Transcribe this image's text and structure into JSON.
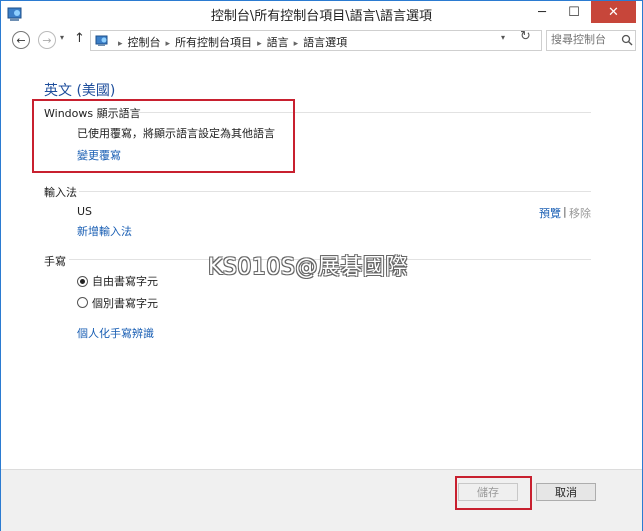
{
  "window": {
    "title": "控制台\\所有控制台項目\\語言\\語言選項",
    "minimize": "─",
    "maximize": "☐",
    "close": "✕"
  },
  "nav": {
    "back": "←",
    "forward": "→",
    "recent": "▾",
    "up": "↑",
    "dropdown": "▾",
    "refresh": "↻"
  },
  "breadcrumb": [
    "控制台",
    "所有控制台項目",
    "語言",
    "語言選項"
  ],
  "breadcrumb_sep": "▸",
  "search": {
    "placeholder": "搜尋控制台"
  },
  "main": {
    "heading": "英文 (美國)",
    "display_language": {
      "title": "Windows 顯示語言",
      "status": "已使用覆寫，將顯示語言設定為其他語言",
      "link": "變更覆寫"
    },
    "input_method": {
      "title": "輸入法",
      "method": "US",
      "preview": "預覽",
      "separator": "|",
      "remove": "移除",
      "add": "新增輸入法"
    },
    "handwriting": {
      "title": "手寫",
      "options": [
        {
          "label": "自由書寫字元",
          "checked": true
        },
        {
          "label": "個別書寫字元",
          "checked": false
        }
      ],
      "personalize_link": "個人化手寫辨識"
    }
  },
  "watermark": "KS010S@展碁國際",
  "footer": {
    "save": "儲存",
    "cancel": "取消"
  },
  "colors": {
    "link": "#1a5fb4",
    "heading": "#1e4e9c",
    "highlight_box": "#c8202f",
    "close_button": "#c7463a"
  }
}
